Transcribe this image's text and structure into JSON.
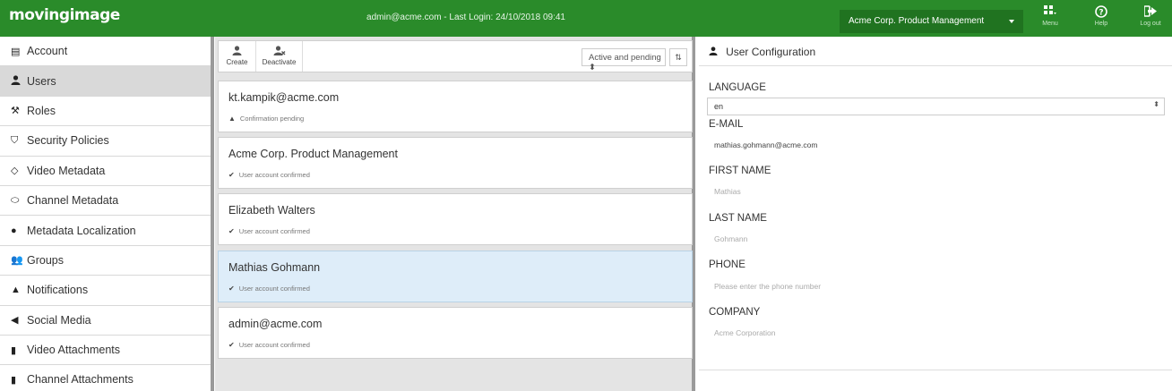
{
  "topbar": {
    "logo": "movingimage",
    "login_info": "admin@acme.com - Last Login: 24/10/2018 09:41",
    "org_select": "Acme Corp. Product Management",
    "menu_label": "Menu",
    "help_label": "Help",
    "logout_label": "Log out",
    "brand_color": "#2a8b2a"
  },
  "sidebar": {
    "items": [
      {
        "label": "Account",
        "icon": "account-card-icon"
      },
      {
        "label": "Users",
        "icon": "user-icon"
      },
      {
        "label": "Roles",
        "icon": "gavel-icon"
      },
      {
        "label": "Security Policies",
        "icon": "shield-icon"
      },
      {
        "label": "Video Metadata",
        "icon": "tag-icon"
      },
      {
        "label": "Channel Metadata",
        "icon": "tags-icon"
      },
      {
        "label": "Metadata Localization",
        "icon": "comments-icon"
      },
      {
        "label": "Groups",
        "icon": "group-icon"
      },
      {
        "label": "Notifications",
        "icon": "bell-icon"
      },
      {
        "label": "Social Media",
        "icon": "share-icon"
      },
      {
        "label": "Video Attachments",
        "icon": "file-icon"
      },
      {
        "label": "Channel Attachments",
        "icon": "file-folded-icon"
      }
    ],
    "active": "Users"
  },
  "toolbar": {
    "create_label": "Create",
    "deactivate_label": "Deactivate",
    "filter_value": "Active and pending"
  },
  "users": [
    {
      "name": "kt.kampik@acme.com",
      "status": "Confirmation pending",
      "status_icon": "warning-icon"
    },
    {
      "name": "Acme Corp. Product Management",
      "status": "User account confirmed",
      "status_icon": "check-icon"
    },
    {
      "name": "Elizabeth Walters",
      "status": "User account confirmed",
      "status_icon": "check-icon"
    },
    {
      "name": "Mathias Gohmann",
      "status": "User account confirmed",
      "status_icon": "check-icon"
    },
    {
      "name": "admin@acme.com",
      "status": "User account confirmed",
      "status_icon": "check-icon"
    }
  ],
  "selected_user": "Mathias Gohmann",
  "detail": {
    "title": "User Configuration",
    "language_label": "LANGUAGE",
    "language_value": "en",
    "email_label": "E-MAIL",
    "email_value": "mathias.gohmann@acme.com",
    "first_name_label": "FIRST NAME",
    "first_name_value": "Mathias",
    "last_name_label": "LAST NAME",
    "last_name_value": "Gohmann",
    "phone_label": "PHONE",
    "phone_placeholder": "Please enter the phone number",
    "company_label": "COMPANY",
    "company_value": "Acme Corporation"
  }
}
